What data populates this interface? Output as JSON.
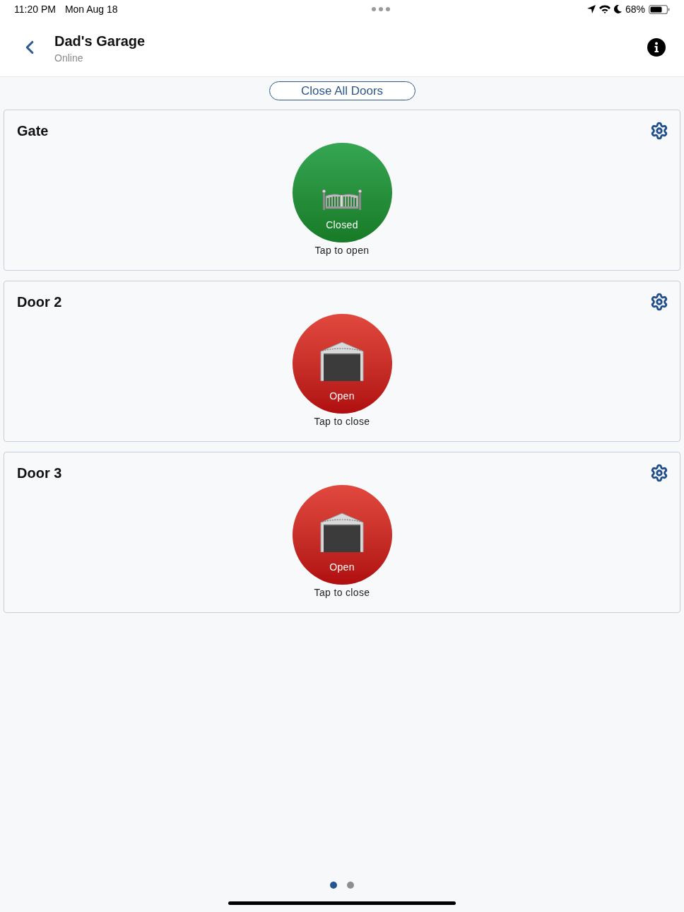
{
  "status_bar": {
    "time": "11:20 PM",
    "date": "Mon Aug 18",
    "battery": "68%"
  },
  "header": {
    "title": "Dad's Garage",
    "subtitle": "Online"
  },
  "close_all_button": "Close All Doors",
  "doors": [
    {
      "name": "Gate",
      "kind": "gate",
      "open": false,
      "status": "Closed",
      "hint": "Tap to open"
    },
    {
      "name": "Door 2",
      "kind": "garage",
      "open": true,
      "status": "Open",
      "hint": "Tap to close"
    },
    {
      "name": "Door 3",
      "kind": "garage",
      "open": true,
      "status": "Open",
      "hint": "Tap to close"
    }
  ],
  "pages": [
    {
      "selected": true
    },
    {
      "selected": false
    }
  ]
}
